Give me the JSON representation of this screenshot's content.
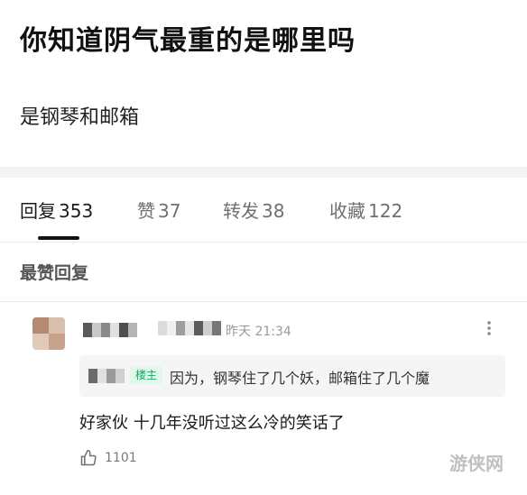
{
  "post": {
    "title": "你知道阴气最重的是哪里吗",
    "body": "是钢琴和邮箱"
  },
  "tabs": [
    {
      "label": "回复",
      "count": "353",
      "active": true
    },
    {
      "label": "赞",
      "count": "37",
      "active": false
    },
    {
      "label": "转发",
      "count": "38",
      "active": false
    },
    {
      "label": "收藏",
      "count": "122",
      "active": false
    }
  ],
  "section": {
    "title": "最赞回复"
  },
  "comment": {
    "timestamp": "昨天 21:34",
    "quote": {
      "badge": "楼主",
      "text": "因为，钢琴住了几个妖，邮箱住了几个魔"
    },
    "text": "好家伙 十几年没听过这么冷的笑话了",
    "likes": "1101"
  },
  "watermark": "游侠网",
  "icons": {
    "more": "more-vertical-icon",
    "like": "thumbs-up-icon"
  },
  "colors": {
    "badge_bg": "#e3f6ec",
    "badge_text": "#20a060",
    "muted_text": "#9a9a9a"
  }
}
